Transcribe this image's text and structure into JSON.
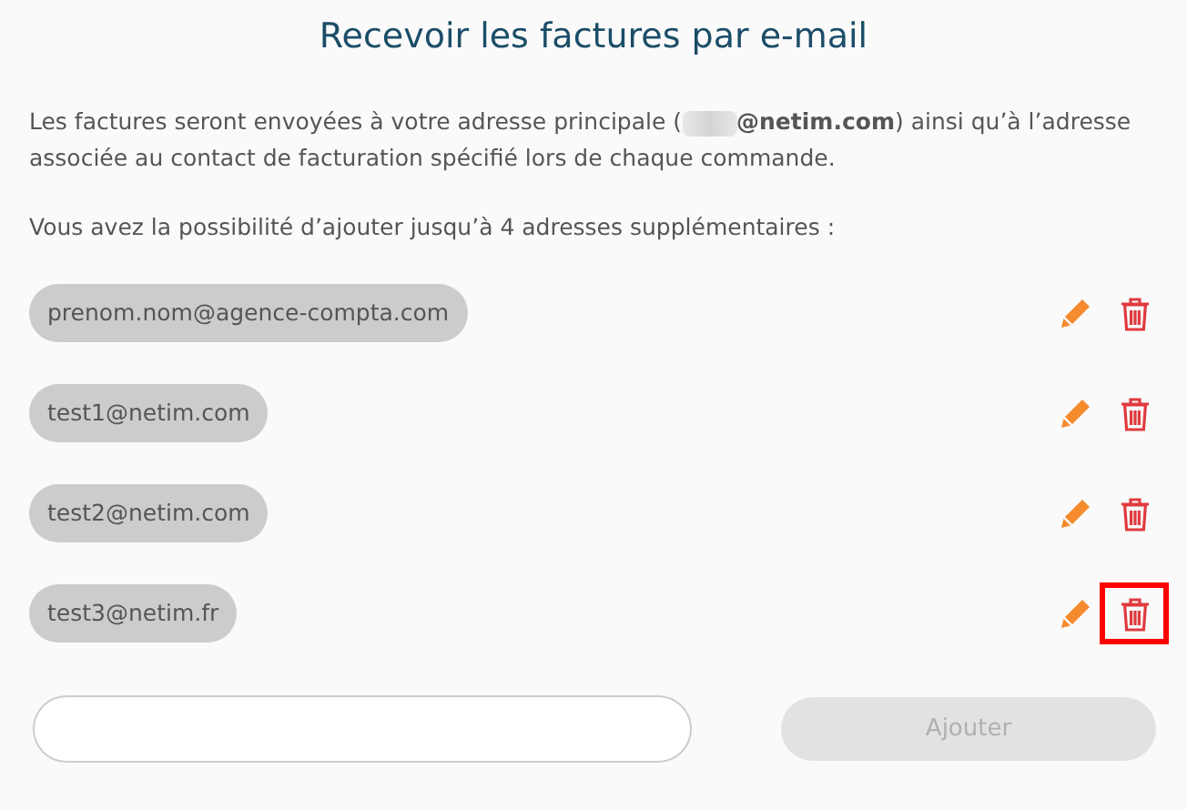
{
  "title": "Recevoir les factures par e-mail",
  "intro_before": "Les factures seront envoyées à votre adresse principale (",
  "intro_after": "**@netim.com**) ainsi qu’à l’adresse associée au contact de facturation spécifié lors de chaque commande.",
  "limit_note": "Vous avez la possibilité d’ajouter jusqu’à 4 adresses supplémentaires :",
  "addresses": [
    {
      "email": "prenom.nom@agence-compta.com",
      "highlighted": false
    },
    {
      "email": "test1@netim.com",
      "highlighted": false
    },
    {
      "email": "test2@netim.com",
      "highlighted": false
    },
    {
      "email": "test3@netim.fr",
      "highlighted": true
    }
  ],
  "add_button": {
    "label": "Ajouter",
    "disabled": true
  }
}
